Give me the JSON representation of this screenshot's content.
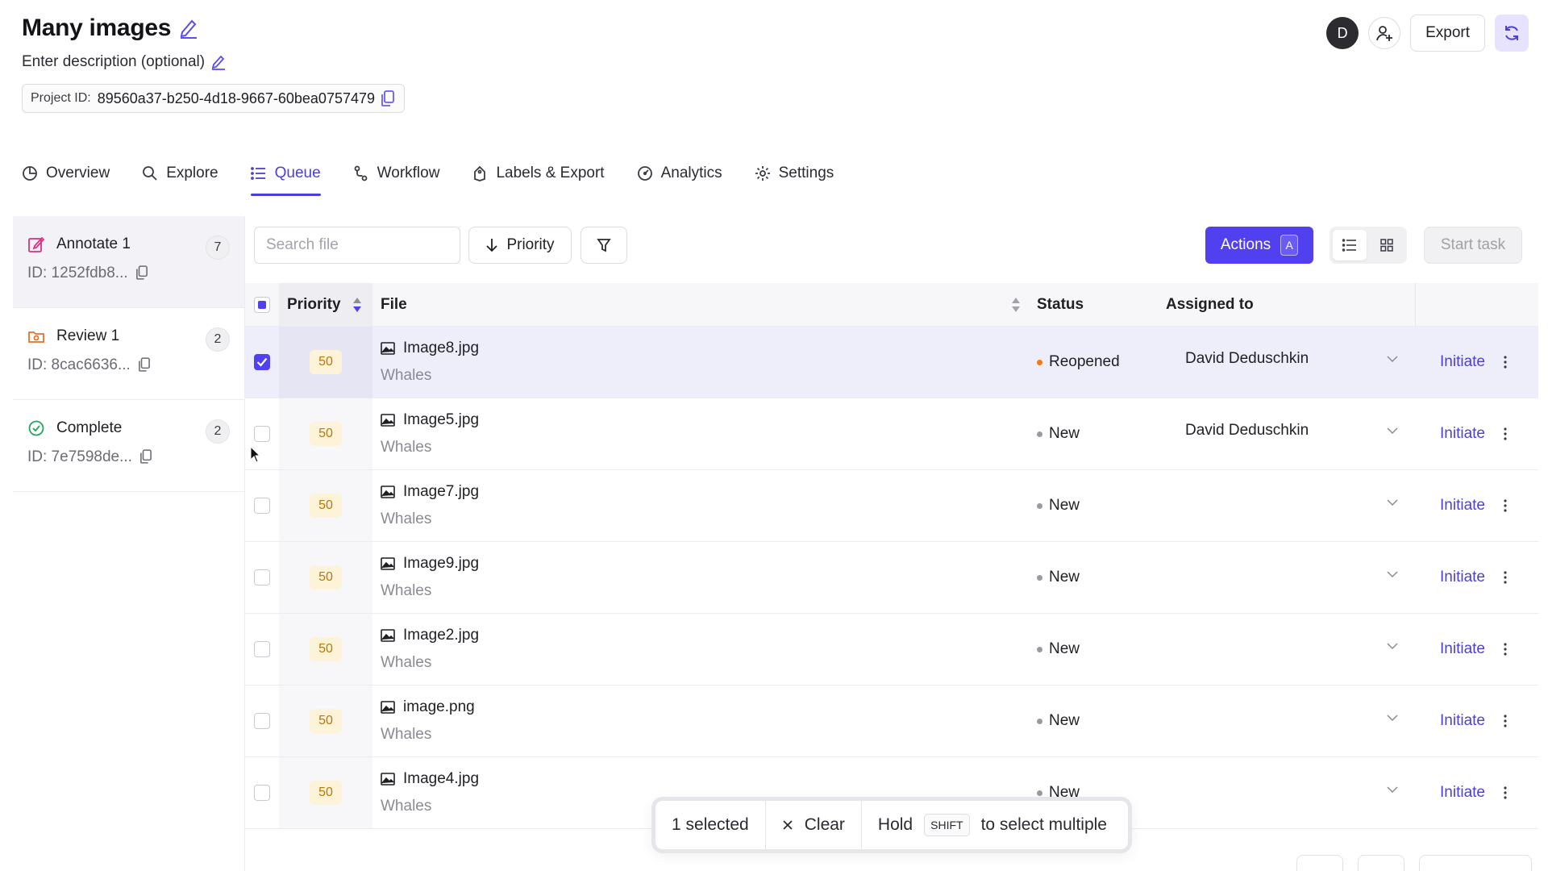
{
  "project": {
    "title": "Many images",
    "description": "Enter description (optional)",
    "id_label": "Project ID:",
    "id_value": "89560a37-b250-4d18-9667-60bea0757479"
  },
  "header": {
    "avatar_initial": "D",
    "export_label": "Export"
  },
  "tabs": [
    {
      "label": "Overview",
      "icon": "pie-chart-icon"
    },
    {
      "label": "Explore",
      "icon": "search-icon"
    },
    {
      "label": "Queue",
      "icon": "list-icon",
      "active": true
    },
    {
      "label": "Workflow",
      "icon": "workflow-icon"
    },
    {
      "label": "Labels & Export",
      "icon": "tag-icon"
    },
    {
      "label": "Analytics",
      "icon": "gauge-icon"
    },
    {
      "label": "Settings",
      "icon": "gear-icon"
    }
  ],
  "stages": [
    {
      "name": "Annotate 1",
      "count": "7",
      "id": "ID: 1252fdb8...",
      "icon": "edit-icon",
      "color": "#d63384",
      "active": true
    },
    {
      "name": "Review 1",
      "count": "2",
      "id": "ID: 8cac6636...",
      "icon": "review-icon",
      "color": "#e8702a"
    },
    {
      "name": "Complete",
      "count": "2",
      "id": "ID: 7e7598de...",
      "icon": "check-circle-icon",
      "color": "#22a55a"
    }
  ],
  "toolbar": {
    "search_placeholder": "Search file",
    "priority_label": "Priority",
    "actions_label": "Actions",
    "actions_shortcut": "A",
    "start_task_label": "Start task"
  },
  "table": {
    "columns": {
      "priority": "Priority",
      "file": "File",
      "status": "Status",
      "assigned": "Assigned to"
    },
    "rows": [
      {
        "priority": "50",
        "file": "Image8.jpg",
        "folder": "Whales",
        "status": "Reopened",
        "status_color": "#f07a1a",
        "assigned": "David Deduschkin",
        "action": "Initiate",
        "selected": true
      },
      {
        "priority": "50",
        "file": "Image5.jpg",
        "folder": "Whales",
        "status": "New",
        "status_color": "#9a9aa2",
        "assigned": "David Deduschkin",
        "action": "Initiate",
        "selected": false
      },
      {
        "priority": "50",
        "file": "Image7.jpg",
        "folder": "Whales",
        "status": "New",
        "status_color": "#9a9aa2",
        "assigned": "",
        "action": "Initiate",
        "selected": false
      },
      {
        "priority": "50",
        "file": "Image9.jpg",
        "folder": "Whales",
        "status": "New",
        "status_color": "#9a9aa2",
        "assigned": "",
        "action": "Initiate",
        "selected": false
      },
      {
        "priority": "50",
        "file": "Image2.jpg",
        "folder": "Whales",
        "status": "New",
        "status_color": "#9a9aa2",
        "assigned": "",
        "action": "Initiate",
        "selected": false
      },
      {
        "priority": "50",
        "file": "image.png",
        "folder": "Whales",
        "status": "New",
        "status_color": "#9a9aa2",
        "assigned": "",
        "action": "Initiate",
        "selected": false
      },
      {
        "priority": "50",
        "file": "Image4.jpg",
        "folder": "Whales",
        "status": "New",
        "status_color": "#9a9aa2",
        "assigned": "",
        "action": "Initiate",
        "selected": false
      }
    ]
  },
  "selection_bar": {
    "count_text": "1 selected",
    "clear_label": "Clear",
    "hint_prefix": "Hold",
    "hint_key": "SHIFT",
    "hint_suffix": "to select multiple"
  },
  "colors": {
    "accent": "#5140f0",
    "priority_badge_bg": "#fdf3d9",
    "priority_badge_text": "#b87708"
  }
}
